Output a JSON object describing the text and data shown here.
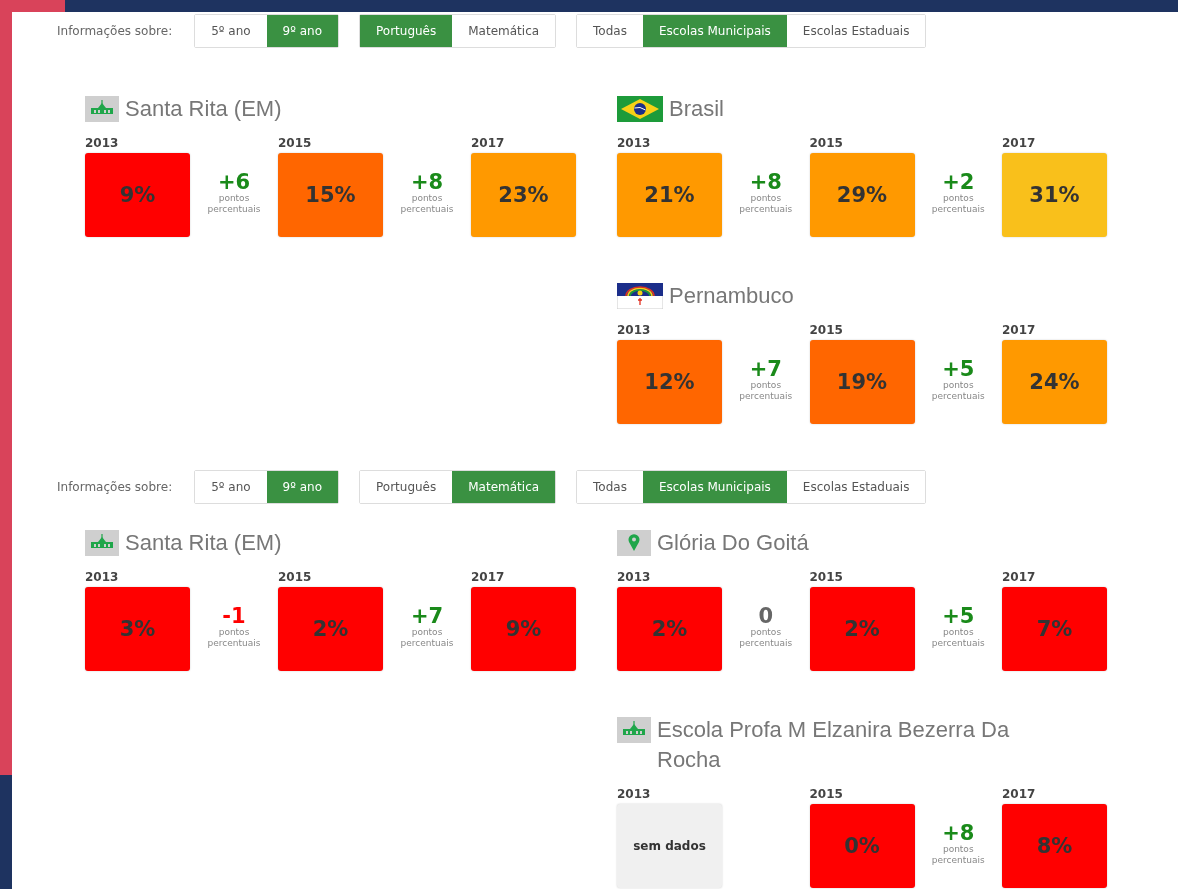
{
  "sections": [
    {
      "filters": {
        "label": "Informações sobre:",
        "groups": [
          [
            {
              "label": "5º ano",
              "selected": false
            },
            {
              "label": "9º ano",
              "selected": true
            }
          ],
          [
            {
              "label": "Português",
              "selected": true
            },
            {
              "label": "Matemática",
              "selected": false
            }
          ],
          [
            {
              "label": "Todas",
              "selected": false
            },
            {
              "label": "Escolas Municipais",
              "selected": true
            },
            {
              "label": "Escolas Estaduais",
              "selected": false
            }
          ]
        ]
      },
      "columns": [
        [
          {
            "kind": "school",
            "name": "Santa Rita (EM)",
            "years": [
              {
                "year": "2013",
                "value": "9%",
                "color": "#ff0000"
              },
              {
                "year": "2015",
                "value": "15%",
                "color": "#ff6600",
                "change": {
                  "value": "+6",
                  "color": "#1a8a1a",
                  "unit": "pontos percentuais"
                }
              },
              {
                "year": "2017",
                "value": "23%",
                "color": "#ff9900",
                "change": {
                  "value": "+8",
                  "color": "#1a8a1a",
                  "unit": "pontos percentuais"
                }
              }
            ]
          }
        ],
        [
          {
            "kind": "country",
            "name": "Brasil",
            "years": [
              {
                "year": "2013",
                "value": "21%",
                "color": "#ff9900"
              },
              {
                "year": "2015",
                "value": "29%",
                "color": "#ff9900",
                "change": {
                  "value": "+8",
                  "color": "#1a8a1a",
                  "unit": "pontos percentuais"
                }
              },
              {
                "year": "2017",
                "value": "31%",
                "color": "#f9c01b",
                "change": {
                  "value": "+2",
                  "color": "#1a8a1a",
                  "unit": "pontos percentuais"
                }
              }
            ]
          },
          {
            "kind": "state",
            "name": "Pernambuco",
            "years": [
              {
                "year": "2013",
                "value": "12%",
                "color": "#ff6600"
              },
              {
                "year": "2015",
                "value": "19%",
                "color": "#ff6600",
                "change": {
                  "value": "+7",
                  "color": "#1a8a1a",
                  "unit": "pontos percentuais"
                }
              },
              {
                "year": "2017",
                "value": "24%",
                "color": "#ff9900",
                "change": {
                  "value": "+5",
                  "color": "#1a8a1a",
                  "unit": "pontos percentuais"
                }
              }
            ]
          }
        ]
      ]
    },
    {
      "filters": {
        "label": "Informações sobre:",
        "groups": [
          [
            {
              "label": "5º ano",
              "selected": false
            },
            {
              "label": "9º ano",
              "selected": true
            }
          ],
          [
            {
              "label": "Português",
              "selected": false
            },
            {
              "label": "Matemática",
              "selected": true
            }
          ],
          [
            {
              "label": "Todas",
              "selected": false
            },
            {
              "label": "Escolas Municipais",
              "selected": true
            },
            {
              "label": "Escolas Estaduais",
              "selected": false
            }
          ]
        ]
      },
      "columns": [
        [
          {
            "kind": "school",
            "name": "Santa Rita (EM)",
            "years": [
              {
                "year": "2013",
                "value": "3%",
                "color": "#ff0000"
              },
              {
                "year": "2015",
                "value": "2%",
                "color": "#ff0000",
                "change": {
                  "value": "-1",
                  "color": "#ff0000",
                  "unit": "pontos percentuais"
                }
              },
              {
                "year": "2017",
                "value": "9%",
                "color": "#ff0000",
                "change": {
                  "value": "+7",
                  "color": "#1a8a1a",
                  "unit": "pontos percentuais"
                }
              }
            ]
          }
        ],
        [
          {
            "kind": "city",
            "name": "Glória Do Goitá",
            "years": [
              {
                "year": "2013",
                "value": "2%",
                "color": "#ff0000"
              },
              {
                "year": "2015",
                "value": "2%",
                "color": "#ff0000",
                "change": {
                  "value": "0",
                  "color": "#666666",
                  "unit": "pontos percentuais"
                }
              },
              {
                "year": "2017",
                "value": "7%",
                "color": "#ff0000",
                "change": {
                  "value": "+5",
                  "color": "#1a8a1a",
                  "unit": "pontos percentuais"
                }
              }
            ]
          },
          {
            "kind": "school",
            "name": "Escola Profa M Elzanira Bezerra Da Rocha",
            "years": [
              {
                "year": "2013",
                "value": "sem dados",
                "color": "#f0f0f0"
              },
              {
                "year": "2015",
                "value": "0%",
                "color": "#ff0000"
              },
              {
                "year": "2017",
                "value": "8%",
                "color": "#ff0000",
                "change": {
                  "value": "+8",
                  "color": "#1a8a1a",
                  "unit": "pontos percentuais"
                }
              }
            ]
          }
        ]
      ]
    }
  ]
}
